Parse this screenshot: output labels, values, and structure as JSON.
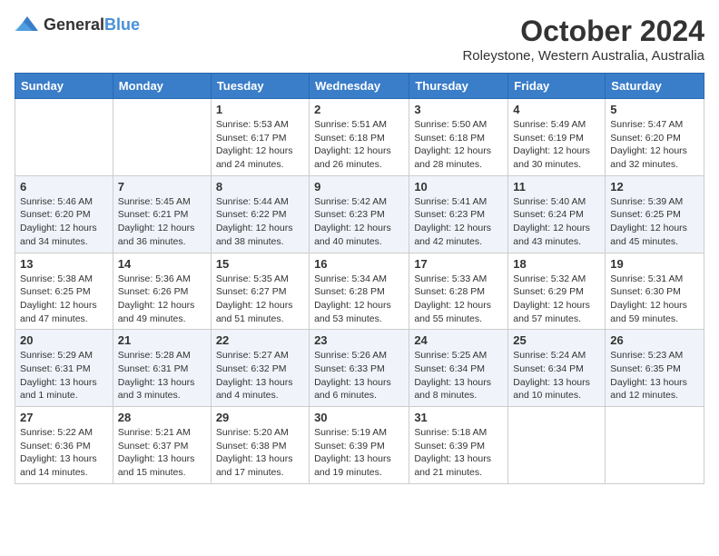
{
  "header": {
    "logo": {
      "general": "General",
      "blue": "Blue"
    },
    "title": "October 2024",
    "location": "Roleystone, Western Australia, Australia"
  },
  "calendar": {
    "days_of_week": [
      "Sunday",
      "Monday",
      "Tuesday",
      "Wednesday",
      "Thursday",
      "Friday",
      "Saturday"
    ],
    "weeks": [
      [
        {
          "day": "",
          "info": ""
        },
        {
          "day": "",
          "info": ""
        },
        {
          "day": "1",
          "info": "Sunrise: 5:53 AM\nSunset: 6:17 PM\nDaylight: 12 hours and 24 minutes."
        },
        {
          "day": "2",
          "info": "Sunrise: 5:51 AM\nSunset: 6:18 PM\nDaylight: 12 hours and 26 minutes."
        },
        {
          "day": "3",
          "info": "Sunrise: 5:50 AM\nSunset: 6:18 PM\nDaylight: 12 hours and 28 minutes."
        },
        {
          "day": "4",
          "info": "Sunrise: 5:49 AM\nSunset: 6:19 PM\nDaylight: 12 hours and 30 minutes."
        },
        {
          "day": "5",
          "info": "Sunrise: 5:47 AM\nSunset: 6:20 PM\nDaylight: 12 hours and 32 minutes."
        }
      ],
      [
        {
          "day": "6",
          "info": "Sunrise: 5:46 AM\nSunset: 6:20 PM\nDaylight: 12 hours and 34 minutes."
        },
        {
          "day": "7",
          "info": "Sunrise: 5:45 AM\nSunset: 6:21 PM\nDaylight: 12 hours and 36 minutes."
        },
        {
          "day": "8",
          "info": "Sunrise: 5:44 AM\nSunset: 6:22 PM\nDaylight: 12 hours and 38 minutes."
        },
        {
          "day": "9",
          "info": "Sunrise: 5:42 AM\nSunset: 6:23 PM\nDaylight: 12 hours and 40 minutes."
        },
        {
          "day": "10",
          "info": "Sunrise: 5:41 AM\nSunset: 6:23 PM\nDaylight: 12 hours and 42 minutes."
        },
        {
          "day": "11",
          "info": "Sunrise: 5:40 AM\nSunset: 6:24 PM\nDaylight: 12 hours and 43 minutes."
        },
        {
          "day": "12",
          "info": "Sunrise: 5:39 AM\nSunset: 6:25 PM\nDaylight: 12 hours and 45 minutes."
        }
      ],
      [
        {
          "day": "13",
          "info": "Sunrise: 5:38 AM\nSunset: 6:25 PM\nDaylight: 12 hours and 47 minutes."
        },
        {
          "day": "14",
          "info": "Sunrise: 5:36 AM\nSunset: 6:26 PM\nDaylight: 12 hours and 49 minutes."
        },
        {
          "day": "15",
          "info": "Sunrise: 5:35 AM\nSunset: 6:27 PM\nDaylight: 12 hours and 51 minutes."
        },
        {
          "day": "16",
          "info": "Sunrise: 5:34 AM\nSunset: 6:28 PM\nDaylight: 12 hours and 53 minutes."
        },
        {
          "day": "17",
          "info": "Sunrise: 5:33 AM\nSunset: 6:28 PM\nDaylight: 12 hours and 55 minutes."
        },
        {
          "day": "18",
          "info": "Sunrise: 5:32 AM\nSunset: 6:29 PM\nDaylight: 12 hours and 57 minutes."
        },
        {
          "day": "19",
          "info": "Sunrise: 5:31 AM\nSunset: 6:30 PM\nDaylight: 12 hours and 59 minutes."
        }
      ],
      [
        {
          "day": "20",
          "info": "Sunrise: 5:29 AM\nSunset: 6:31 PM\nDaylight: 13 hours and 1 minute."
        },
        {
          "day": "21",
          "info": "Sunrise: 5:28 AM\nSunset: 6:31 PM\nDaylight: 13 hours and 3 minutes."
        },
        {
          "day": "22",
          "info": "Sunrise: 5:27 AM\nSunset: 6:32 PM\nDaylight: 13 hours and 4 minutes."
        },
        {
          "day": "23",
          "info": "Sunrise: 5:26 AM\nSunset: 6:33 PM\nDaylight: 13 hours and 6 minutes."
        },
        {
          "day": "24",
          "info": "Sunrise: 5:25 AM\nSunset: 6:34 PM\nDaylight: 13 hours and 8 minutes."
        },
        {
          "day": "25",
          "info": "Sunrise: 5:24 AM\nSunset: 6:34 PM\nDaylight: 13 hours and 10 minutes."
        },
        {
          "day": "26",
          "info": "Sunrise: 5:23 AM\nSunset: 6:35 PM\nDaylight: 13 hours and 12 minutes."
        }
      ],
      [
        {
          "day": "27",
          "info": "Sunrise: 5:22 AM\nSunset: 6:36 PM\nDaylight: 13 hours and 14 minutes."
        },
        {
          "day": "28",
          "info": "Sunrise: 5:21 AM\nSunset: 6:37 PM\nDaylight: 13 hours and 15 minutes."
        },
        {
          "day": "29",
          "info": "Sunrise: 5:20 AM\nSunset: 6:38 PM\nDaylight: 13 hours and 17 minutes."
        },
        {
          "day": "30",
          "info": "Sunrise: 5:19 AM\nSunset: 6:39 PM\nDaylight: 13 hours and 19 minutes."
        },
        {
          "day": "31",
          "info": "Sunrise: 5:18 AM\nSunset: 6:39 PM\nDaylight: 13 hours and 21 minutes."
        },
        {
          "day": "",
          "info": ""
        },
        {
          "day": "",
          "info": ""
        }
      ]
    ]
  }
}
